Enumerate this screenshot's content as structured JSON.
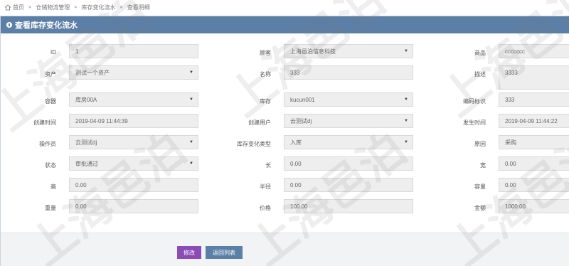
{
  "breadcrumb": {
    "home": "首页",
    "items": [
      "仓储物流管理",
      "库存变化流水",
      "查看明细"
    ]
  },
  "panel": {
    "title": "查看库存变化流水"
  },
  "fields": {
    "id": {
      "label": "ID",
      "value": "1"
    },
    "customer": {
      "label": "顾客",
      "value": "上海邑泊信息科技"
    },
    "product": {
      "label": "商品",
      "value": "ccccccc"
    },
    "asset": {
      "label": "资产",
      "value": "测试一个资产"
    },
    "name": {
      "label": "名称",
      "value": "333"
    },
    "description": {
      "label": "描述",
      "value": "3333"
    },
    "container": {
      "label": "容器",
      "value": "库房00A"
    },
    "stock": {
      "label": "库存",
      "value": "kucun001"
    },
    "code": {
      "label": "编码标识",
      "value": "333"
    },
    "created_time": {
      "label": "创建时间",
      "value": "2019-04-09 11:44:39"
    },
    "created_user": {
      "label": "创建用户",
      "value": "云测试dj"
    },
    "occur_time": {
      "label": "发生时间",
      "value": "2019-04-09 11:44:22"
    },
    "operator": {
      "label": "操作员",
      "value": "云测试dj"
    },
    "change_type": {
      "label": "库存变化类型",
      "value": "入库"
    },
    "reason": {
      "label": "原因",
      "value": "采购"
    },
    "status": {
      "label": "状态",
      "value": "审批通过"
    },
    "length": {
      "label": "长",
      "value": "0.00"
    },
    "width": {
      "label": "宽",
      "value": "0.00"
    },
    "height": {
      "label": "高",
      "value": "0.00"
    },
    "radius": {
      "label": "半径",
      "value": "0.00"
    },
    "volume": {
      "label": "容量",
      "value": "0.00"
    },
    "weight": {
      "label": "重量",
      "value": "0.00"
    },
    "price": {
      "label": "价格",
      "value": "100.00"
    },
    "amount": {
      "label": "金额",
      "value": "1000.00"
    }
  },
  "buttons": {
    "modify": "修改",
    "back": "返回列表"
  },
  "watermark": {
    "text": "上海邑泊"
  }
}
